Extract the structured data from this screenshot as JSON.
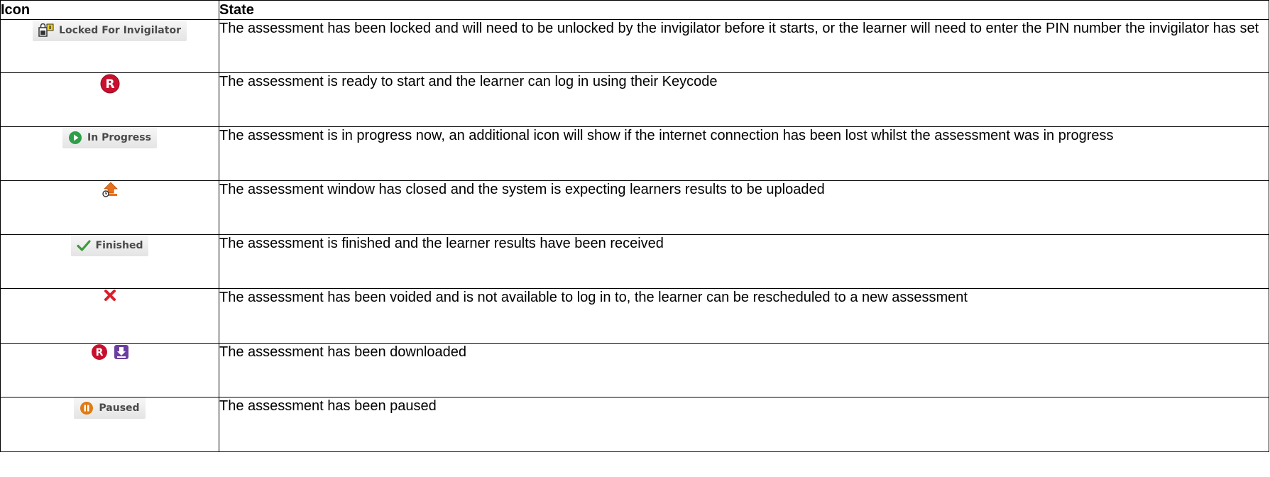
{
  "headers": {
    "icon": "Icon",
    "state": "State"
  },
  "rows": [
    {
      "icon_name": "locked-for-invigilator-icon",
      "icon_label": "Locked For Invigilator",
      "state": "The assessment has been locked and will need to be unlocked by the invigilator before it starts, or the learner will need to enter the PIN number the invigilator has set"
    },
    {
      "icon_name": "ready-icon",
      "state": "The assessment is ready to start and the learner can log in using their Keycode"
    },
    {
      "icon_name": "in-progress-icon",
      "icon_label": "In Progress",
      "state": "The assessment is in progress now, an additional icon will show if the internet connection has been lost whilst the assessment was in progress"
    },
    {
      "icon_name": "upload-expected-icon",
      "state": "The assessment window has closed and the system is expecting learners results to be uploaded"
    },
    {
      "icon_name": "finished-icon",
      "icon_label": "Finished",
      "state": "The assessment is finished and the learner results have been received"
    },
    {
      "icon_name": "voided-icon",
      "state": "The assessment has been voided and is not available to log in to, the learner can be rescheduled to a new assessment"
    },
    {
      "icon_name": "downloaded-icon",
      "state": "The assessment has been downloaded"
    },
    {
      "icon_name": "paused-icon",
      "icon_label": "Paused",
      "state": "The assessment has been paused"
    }
  ],
  "colors": {
    "ready_red": "#c8102e",
    "progress_green": "#2e9e4a",
    "upload_orange": "#e8701a",
    "check_green": "#3c9a3c",
    "void_red": "#d81f2a",
    "download_purple": "#6b3fa0",
    "paused_orange": "#e07a12"
  }
}
